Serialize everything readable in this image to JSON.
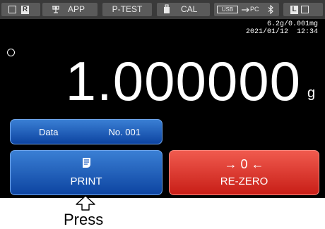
{
  "topbar": {
    "r_label": "R",
    "app_label": "APP",
    "ptest_label": "P-TEST",
    "cal_label": "CAL",
    "usb_label": "USB",
    "pc_label": "PC",
    "l_label": "L"
  },
  "display": {
    "spec": "6.2g/0.001mg",
    "datetime": "2021/01/12  12:34",
    "weight": "1.000000",
    "unit": "g"
  },
  "data_button": {
    "label": "Data",
    "number": "No. 001"
  },
  "print_button": {
    "label": "PRINT"
  },
  "rezero_button": {
    "symbol": "→ 0 ←",
    "label": "RE-ZERO"
  },
  "annotation": {
    "press": "Press"
  },
  "icons": [
    "balance-icon",
    "calculator-icon",
    "usb-icon",
    "bluetooth-icon",
    "print-icon",
    "stable-indicator-icon",
    "arrow-up-icon"
  ],
  "colors": {
    "blue": "#1a5bbf",
    "red": "#e2372c",
    "topbar": "#3a3a3a"
  }
}
